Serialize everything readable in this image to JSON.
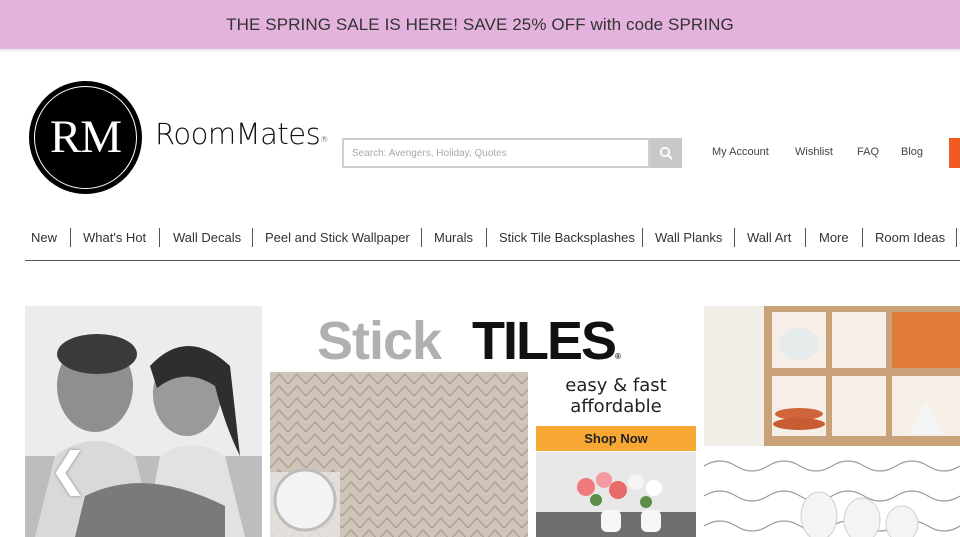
{
  "promo": {
    "text": "THE SPRING SALE IS HERE! SAVE 25% OFF with code SPRING",
    "background": "#e3b3de"
  },
  "brand": {
    "monogram": "RM",
    "wordmark": "RoomMates",
    "registered": "®"
  },
  "search": {
    "placeholder": "Search: Avengers, Holiday, Quotes",
    "icon": "search-icon"
  },
  "account_links": [
    "My Account",
    "Wishlist",
    "FAQ",
    "Blog"
  ],
  "nav": [
    "New",
    "What's Hot",
    "Wall Decals",
    "Peel and Stick Wallpaper",
    "Murals",
    "Stick Tile Backsplashes",
    "Wall Planks",
    "Wall Art",
    "More",
    "Room Ideas"
  ],
  "hero": {
    "stick": "Stick",
    "tiles": "TILES",
    "registered": "®",
    "tagline_1": "easy & fast",
    "tagline_2": "affordable",
    "cta": "Shop Now",
    "prev_arrow": "❮"
  },
  "colors": {
    "accent": "#f15a22",
    "cta": "#f7a833"
  }
}
